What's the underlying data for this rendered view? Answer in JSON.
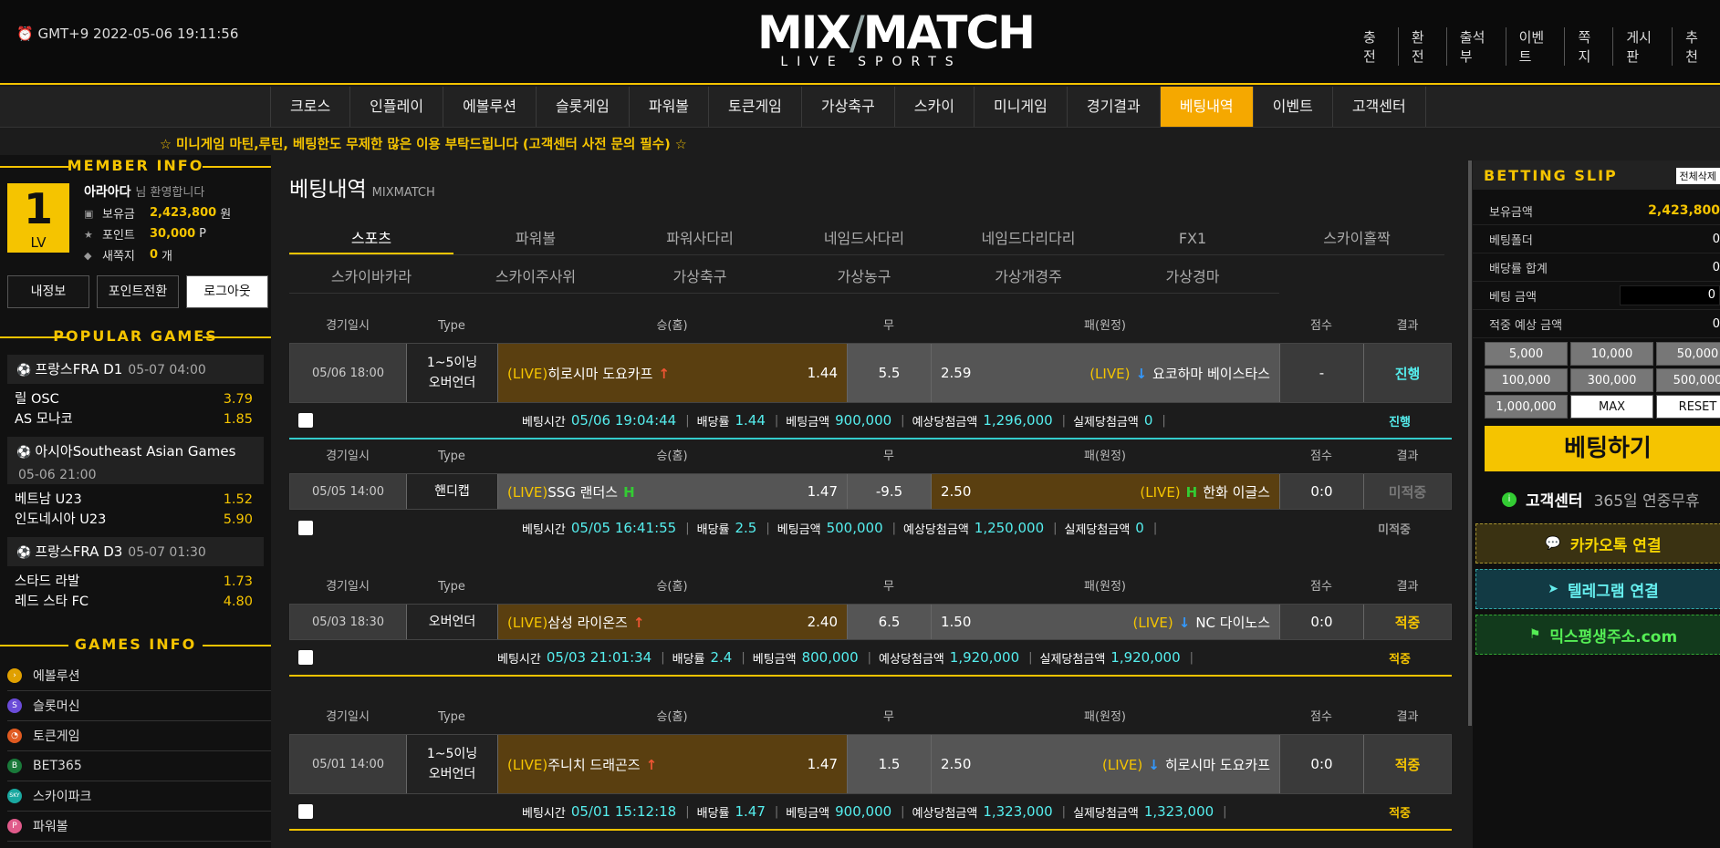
{
  "header": {
    "clock": "⏰ GMT+9 2022-05-06 19:11:56",
    "logo_a": "MIX",
    "logo_b": "MATCH",
    "logo_sub": "LIVE SPORTS",
    "links": [
      "충전",
      "환전",
      "출석부",
      "이벤트",
      "쪽지",
      "게시판",
      "추천"
    ]
  },
  "nav": {
    "items": [
      "크로스",
      "인플레이",
      "에볼루션",
      "슬롯게임",
      "파워볼",
      "토큰게임",
      "가상축구",
      "스카이",
      "미니게임",
      "경기결과",
      "베팅내역",
      "이벤트",
      "고객센터"
    ],
    "active_index": 10
  },
  "notice": "☆ 미니게임 마틴,루틴, 베팅한도 무제한 많은 이용 부탁드립니다 (고객센터 사전 문의 필수) ☆",
  "member": {
    "title": "MEMBER INFO",
    "level": "1",
    "level_label": "LV",
    "name": "아라아다",
    "welcome": "님 환영합니다",
    "balance_label": "보유금",
    "balance": "2,423,800",
    "balance_unit": "원",
    "point_label": "포인트",
    "point": "30,000",
    "point_unit": "P",
    "msg_label": "새쪽지",
    "msg": "0",
    "msg_unit": "개",
    "buttons": [
      "내정보",
      "포인트전환",
      "로그아웃"
    ]
  },
  "popular": {
    "title": "POPULAR GAMES",
    "games": [
      {
        "league": "프랑스FRA D1",
        "time": "05-07 04:00",
        "teams": [
          {
            "name": "릴 OSC",
            "odds": "3.79"
          },
          {
            "name": "AS 모나코",
            "odds": "1.85"
          }
        ]
      },
      {
        "league": "아시아Southeast Asian Games",
        "time": "05-06 21:00",
        "teams": [
          {
            "name": "베트남 U23",
            "odds": "1.52"
          },
          {
            "name": "인도네시아 U23",
            "odds": "5.90"
          }
        ]
      },
      {
        "league": "프랑스FRA D3",
        "time": "05-07 01:30",
        "teams": [
          {
            "name": "스타드 라발",
            "odds": "1.73"
          },
          {
            "name": "레드 스타 FC",
            "odds": "4.80"
          }
        ]
      }
    ]
  },
  "games_info": {
    "title": "GAMES INFO",
    "items": [
      {
        "label": "에볼루션",
        "color": "#e0a000",
        "glyph": "›"
      },
      {
        "label": "슬롯머신",
        "color": "#6a4bd8",
        "glyph": "S"
      },
      {
        "label": "토큰게임",
        "color": "#e05a20",
        "glyph": "◔"
      },
      {
        "label": "BET365",
        "color": "#1a7a3a",
        "glyph": "B"
      },
      {
        "label": "스카이파크",
        "color": "#1aa8a0",
        "glyph": "SKY"
      },
      {
        "label": "파워볼",
        "color": "#e05a8a",
        "glyph": "P"
      }
    ]
  },
  "main": {
    "title": "베팅내역",
    "subtitle": "MIXMATCH",
    "tabs1": [
      "스포츠",
      "파워볼",
      "파워사다리",
      "네임드사다리",
      "네임드다리다리",
      "FX1",
      "스카이홀짝"
    ],
    "tabs2": [
      "스카이바카라",
      "스카이주사위",
      "가상축구",
      "가상농구",
      "가상개경주",
      "가상경마"
    ],
    "headers": [
      "경기일시",
      "Type",
      "승(홈)",
      "무",
      "패(원정)",
      "점수",
      "결과"
    ],
    "info_labels": {
      "time": "베팅시간",
      "odds": "배당률",
      "amount": "베팅금액",
      "expected": "예상당첨금액",
      "actual": "실제당첨금액"
    },
    "bets": [
      {
        "date": "05/06 18:00",
        "type": "1~5이닝 오버언더",
        "home_live": "(LIVE)",
        "home": "히로시마 도요카프",
        "home_mark": "↑",
        "home_odds": "1.44",
        "draw": "5.5",
        "away_odds": "2.59",
        "away_live": "(LIVE)",
        "away_mark": "↓",
        "away": "요코하마 베이스타스",
        "score": "-",
        "result": "진행",
        "result_color": "#5ee",
        "time": "05/06 19:04:44",
        "odds": "1.44",
        "amount": "900,000",
        "expected": "1,296,000",
        "actual": "0",
        "status": "진행",
        "status_color": "#5ee",
        "line_color": "#3cc",
        "home_selected": true
      },
      {
        "date": "05/05 14:00",
        "type": "핸디캡",
        "home_live": "(LIVE)",
        "home": "SSG 랜더스",
        "home_mark": "H",
        "home_odds": "1.47",
        "draw": "-9.5",
        "away_odds": "2.50",
        "away_live": "(LIVE)",
        "away_mark": "H",
        "away": "한화 이글스",
        "score": "0:0",
        "result": "미적중",
        "result_color": "#777",
        "time": "05/05 16:41:55",
        "odds": "2.5",
        "amount": "500,000",
        "expected": "1,250,000",
        "actual": "0",
        "status": "미적중",
        "status_color": "#999",
        "line_color": "none",
        "home_selected": false
      },
      {
        "date": "05/03 18:30",
        "type": "오버언더",
        "home_live": "(LIVE)",
        "home": "삼성 라이온즈",
        "home_mark": "↑",
        "home_odds": "2.40",
        "draw": "6.5",
        "away_odds": "1.50",
        "away_live": "(LIVE)",
        "away_mark": "↓",
        "away": "NC 다이노스",
        "score": "0:0",
        "result": "적중",
        "result_color": "#f5c400",
        "time": "05/03 21:01:34",
        "odds": "2.4",
        "amount": "800,000",
        "expected": "1,920,000",
        "actual": "1,920,000",
        "status": "적중",
        "status_color": "#f5c400",
        "line_color": "#f5c400",
        "home_selected": true
      },
      {
        "date": "05/01 14:00",
        "type": "1~5이닝 오버언더",
        "home_live": "(LIVE)",
        "home": "주니치 드래곤즈",
        "home_mark": "↑",
        "home_odds": "1.47",
        "draw": "1.5",
        "away_odds": "2.50",
        "away_live": "(LIVE)",
        "away_mark": "↓",
        "away": "히로시마 도요카프",
        "score": "0:0",
        "result": "적중",
        "result_color": "#f5c400",
        "time": "05/01 15:12:18",
        "odds": "1.47",
        "amount": "900,000",
        "expected": "1,323,000",
        "actual": "1,323,000",
        "status": "적중",
        "status_color": "#f5c400",
        "line_color": "#f5c400",
        "home_selected": true
      }
    ]
  },
  "slip": {
    "title": "BETTING SLIP",
    "clear": "전체삭제",
    "balance_label": "보유금액",
    "balance": "2,423,800",
    "folder_label": "베팅폴더",
    "folder": "0",
    "odds_label": "배당률 합계",
    "odds": "0",
    "amount_label": "베팅 금액",
    "amount": "0",
    "expected_label": "적중 예상 금액",
    "expected": "0",
    "chips": [
      "5,000",
      "10,000",
      "50,000",
      "100,000",
      "300,000",
      "500,000",
      "1,000,000",
      "MAX",
      "RESET"
    ],
    "bet_button": "베팅하기",
    "cs_title": "고객센터",
    "cs_sub": "365일 연중무휴",
    "kakao": "카카오톡 연결",
    "telegram": "텔레그램 연결",
    "address": "믹스평생주소.com"
  }
}
